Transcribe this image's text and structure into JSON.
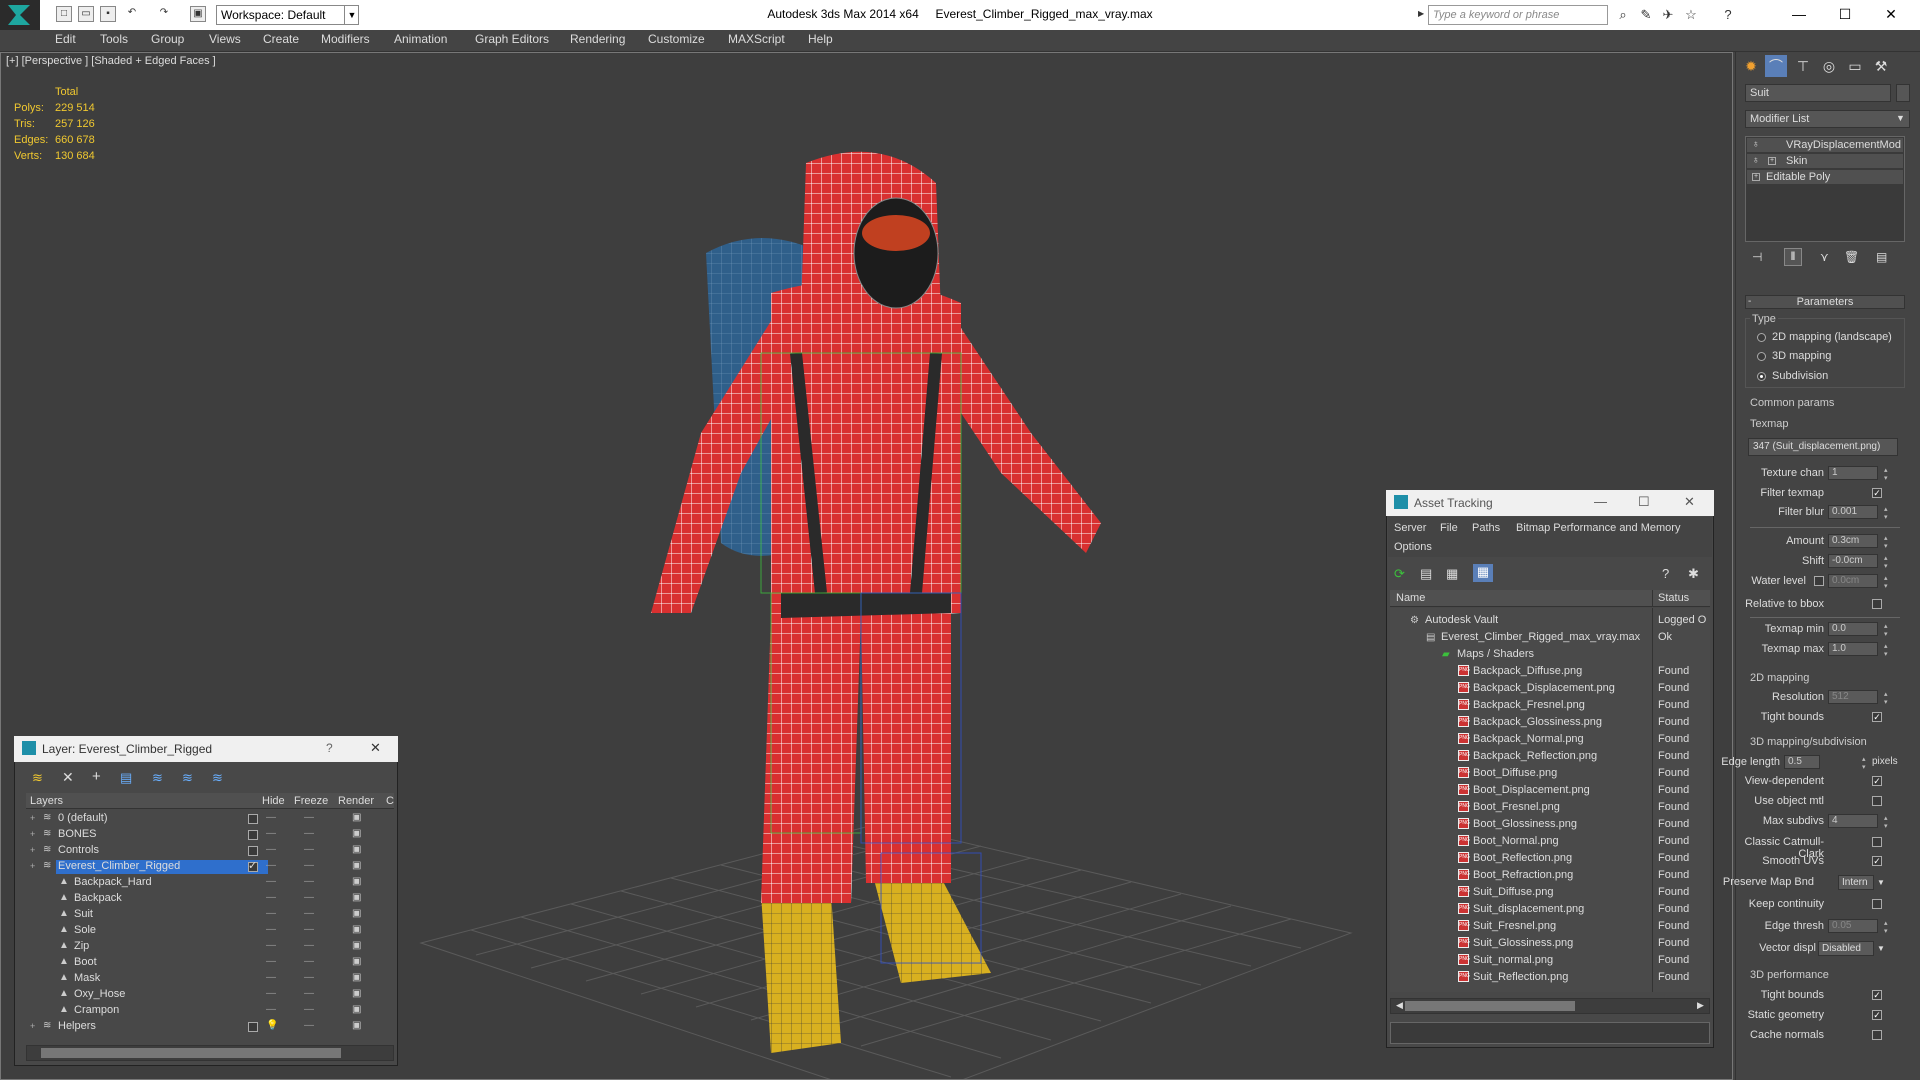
{
  "title_bar": {
    "workspace": "Workspace: Default",
    "app_title": "Autodesk 3ds Max  2014 x64",
    "file_title": "Everest_Climber_Rigged_max_vray.max",
    "search_placeholder": "Type a keyword or phrase"
  },
  "menu": [
    "Edit",
    "Tools",
    "Group",
    "Views",
    "Create",
    "Modifiers",
    "Animation",
    "Graph Editors",
    "Rendering",
    "Customize",
    "MAXScript",
    "Help"
  ],
  "viewport": {
    "label": "[+] [Perspective ] [Shaded + Edged Faces ]",
    "stats_header": "Total",
    "stats": [
      {
        "label": "Polys:",
        "value": "229 514"
      },
      {
        "label": "Tris:",
        "value": "257 126"
      },
      {
        "label": "Edges:",
        "value": "660 678"
      },
      {
        "label": "Verts:",
        "value": "130 684"
      }
    ]
  },
  "command_panel": {
    "object_name": "Suit",
    "modifier_list": "Modifier List",
    "stack": [
      "VRayDisplacementMod",
      "Skin",
      "Editable Poly"
    ],
    "parameters_title": "Parameters",
    "type_group": "Type",
    "type_options": [
      "2D mapping (landscape)",
      "3D mapping",
      "Subdivision"
    ],
    "common_group": "Common params",
    "texmap_label": "Texmap",
    "texmap_value": "347 (Suit_displacement.png)",
    "texture_chan": {
      "label": "Texture chan",
      "value": "1"
    },
    "filter_texmap": "Filter texmap",
    "filter_blur": {
      "label": "Filter blur",
      "value": "0.001"
    },
    "amount": {
      "label": "Amount",
      "value": "0.3cm"
    },
    "shift": {
      "label": "Shift",
      "value": "-0.0cm"
    },
    "water_level": {
      "label": "Water level",
      "value": "0.0cm"
    },
    "relative_bbox": "Relative to bbox",
    "texmap_min": {
      "label": "Texmap min",
      "value": "0.0"
    },
    "texmap_max": {
      "label": "Texmap max",
      "value": "1.0"
    },
    "mapping2d_group": "2D mapping",
    "resolution": {
      "label": "Resolution",
      "value": "512"
    },
    "tight_bounds_2d": "Tight bounds",
    "mapping3d_group": "3D mapping/subdivision",
    "edge_length": {
      "label": "Edge length",
      "value": "0.5",
      "unit": "pixels"
    },
    "view_dependent": "View-dependent",
    "use_object_mtl": "Use object mtl",
    "max_subdivs": {
      "label": "Max subdivs",
      "value": "4"
    },
    "classic_catmull": "Classic Catmull-Clark",
    "smooth_uvs": "Smooth UVs",
    "preserve_map": {
      "label": "Preserve Map Bnd",
      "value": "Intern"
    },
    "keep_continuity": "Keep continuity",
    "edge_thresh": {
      "label": "Edge thresh",
      "value": "0.05"
    },
    "vector_displ": {
      "label": "Vector displ",
      "value": "Disabled"
    },
    "perf_group": "3D performance",
    "tight_bounds_3d": "Tight bounds",
    "static_geometry": "Static geometry",
    "cache_normals": "Cache normals"
  },
  "layer_window": {
    "title": "Layer: Everest_Climber_Rigged",
    "help": "?",
    "columns": [
      "Layers",
      "Hide",
      "Freeze",
      "Render",
      "C"
    ],
    "rows": [
      {
        "name": "0 (default)",
        "level": 0
      },
      {
        "name": "BONES",
        "level": 0
      },
      {
        "name": "Controls",
        "level": 0
      },
      {
        "name": "Everest_Climber_Rigged",
        "level": 0
      },
      {
        "name": "Backpack_Hard",
        "level": 1
      },
      {
        "name": "Backpack",
        "level": 1
      },
      {
        "name": "Suit",
        "level": 1
      },
      {
        "name": "Sole",
        "level": 1
      },
      {
        "name": "Zip",
        "level": 1
      },
      {
        "name": "Boot",
        "level": 1
      },
      {
        "name": "Mask",
        "level": 1
      },
      {
        "name": "Oxy_Hose",
        "level": 1
      },
      {
        "name": "Crampon",
        "level": 1
      },
      {
        "name": "Helpers",
        "level": 0
      }
    ]
  },
  "asset_window": {
    "title": "Asset Tracking",
    "menu": [
      "Server",
      "File",
      "Paths",
      "Bitmap Performance and Memory",
      "Options"
    ],
    "columns": [
      "Name",
      "Status"
    ],
    "rows": [
      {
        "name": "Autodesk Vault",
        "status": "Logged O"
      },
      {
        "name": "Everest_Climber_Rigged_max_vray.max",
        "status": "Ok"
      },
      {
        "name": "Maps / Shaders",
        "status": ""
      },
      {
        "name": "Backpack_Diffuse.png",
        "status": "Found"
      },
      {
        "name": "Backpack_Displacement.png",
        "status": "Found"
      },
      {
        "name": "Backpack_Fresnel.png",
        "status": "Found"
      },
      {
        "name": "Backpack_Glossiness.png",
        "status": "Found"
      },
      {
        "name": "Backpack_Normal.png",
        "status": "Found"
      },
      {
        "name": "Backpack_Reflection.png",
        "status": "Found"
      },
      {
        "name": "Boot_Diffuse.png",
        "status": "Found"
      },
      {
        "name": "Boot_Displacement.png",
        "status": "Found"
      },
      {
        "name": "Boot_Fresnel.png",
        "status": "Found"
      },
      {
        "name": "Boot_Glossiness.png",
        "status": "Found"
      },
      {
        "name": "Boot_Normal.png",
        "status": "Found"
      },
      {
        "name": "Boot_Reflection.png",
        "status": "Found"
      },
      {
        "name": "Boot_Refraction.png",
        "status": "Found"
      },
      {
        "name": "Suit_Diffuse.png",
        "status": "Found"
      },
      {
        "name": "Suit_displacement.png",
        "status": "Found"
      },
      {
        "name": "Suit_Fresnel.png",
        "status": "Found"
      },
      {
        "name": "Suit_Glossiness.png",
        "status": "Found"
      },
      {
        "name": "Suit_normal.png",
        "status": "Found"
      },
      {
        "name": "Suit_Reflection.png",
        "status": "Found"
      }
    ]
  },
  "colors": {
    "accent": "#2f6fcc",
    "stats": "#f0c830",
    "suit": "#d93030",
    "wire": "#ffffff"
  }
}
